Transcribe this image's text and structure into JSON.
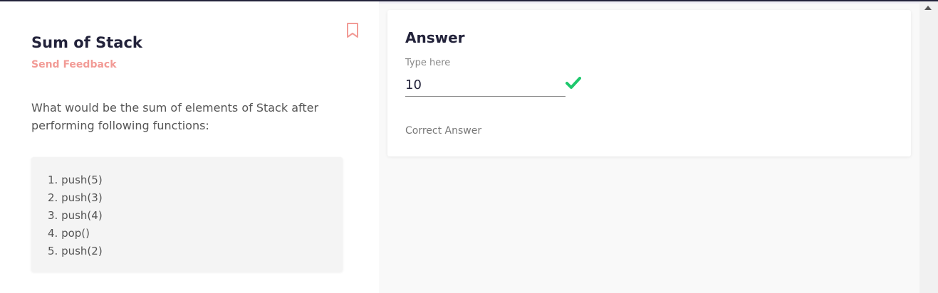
{
  "question": {
    "title": "Sum of Stack",
    "feedback_label": "Send Feedback",
    "text": "What would be the sum of elements of Stack after performing following functions:",
    "steps": [
      "1. push(5)",
      "2. push(3)",
      "3. push(4)",
      "4. pop()",
      "5. push(2)"
    ],
    "bookmark_icon": "bookmark-icon"
  },
  "answer": {
    "heading": "Answer",
    "input_label": "Type here",
    "input_value": "10",
    "status_icon": "check-icon",
    "status_color": "#1ec86d",
    "result_label": "Correct Answer"
  },
  "colors": {
    "accent": "#f29b96",
    "title": "#22223a"
  }
}
